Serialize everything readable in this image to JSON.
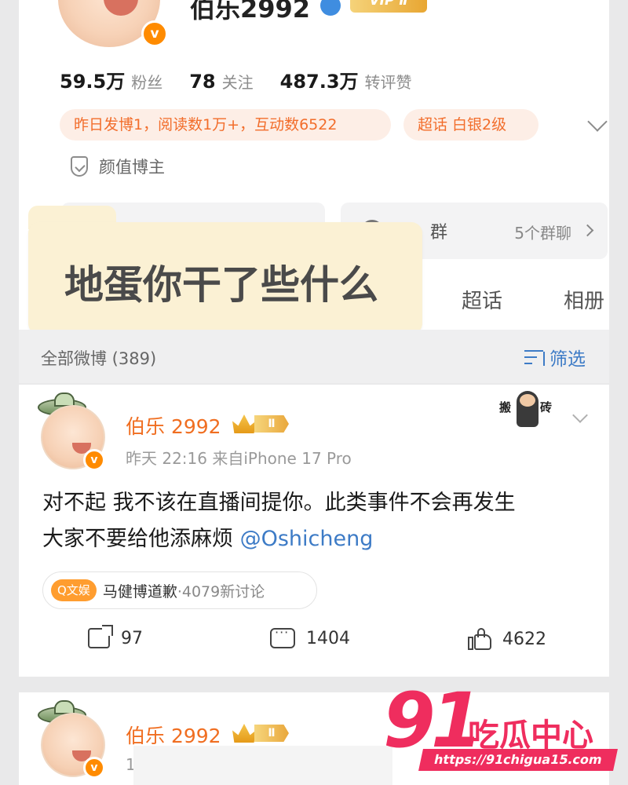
{
  "profile": {
    "username": "伯乐2992",
    "verify_badge": "v",
    "vip_label": "VIP Ⅱ",
    "stats": [
      {
        "value": "59.5万",
        "label": "粉丝"
      },
      {
        "value": "78",
        "label": "关注"
      },
      {
        "value": "487.3万",
        "label": "转评赞"
      }
    ],
    "activity_chip": "昨日发博1，阅读数1万+，互动数6522",
    "supertopic_chip": "超话 白银2级",
    "tag": "颜值博主",
    "group_title_tail": "群",
    "group_count": "5个群聊"
  },
  "tabs": {
    "chaohua": "超话",
    "album": "相册"
  },
  "overlay_text": "地蛋你干了些什么",
  "feed": {
    "count_label": "全部微博 (389)",
    "filter_label": "筛选"
  },
  "post": {
    "author": "伯乐 2992",
    "badge_level": "Ⅱ",
    "meta": "昨天 22:16  来自iPhone 17 Pro",
    "body_line1": "对不起 我不该在直播间提你。此类事件不会再发生",
    "body_line2": "大家不要给他添麻烦 ",
    "mention": "@Oshicheng",
    "topic_tag": "Q文娱",
    "topic_name": "马健博道歉",
    "topic_count": "·4079新讨论",
    "shares": "97",
    "comments": "1404",
    "likes": "4622",
    "sticker_text_left": "搬",
    "sticker_text_right": "砖"
  },
  "post2": {
    "author": "伯乐 2992",
    "badge_level": "Ⅱ",
    "meta_partial": "1"
  },
  "watermark": {
    "number": "91",
    "name": "吃瓜中心",
    "url": "https://91chigua15.com"
  },
  "colors": {
    "accent_orange": "#f06e21",
    "link_blue": "#3d7bc6",
    "watermark_pink": "#ef2d5e"
  }
}
